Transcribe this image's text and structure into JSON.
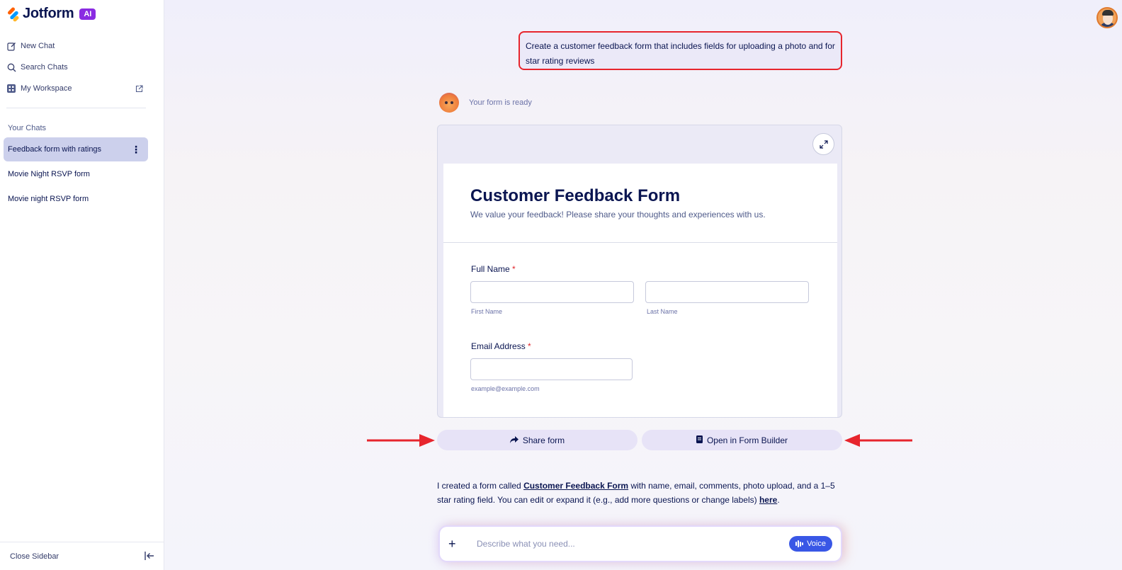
{
  "brand": {
    "name": "Jotform",
    "badge": "AI"
  },
  "sidebar": {
    "nav": [
      {
        "label": "New Chat",
        "icon": "edit-icon"
      },
      {
        "label": "Search Chats",
        "icon": "search-icon"
      },
      {
        "label": "My Workspace",
        "icon": "workspace-icon"
      }
    ],
    "section_title": "Your Chats",
    "chats": [
      {
        "label": "Feedback form with ratings",
        "active": true
      },
      {
        "label": "Movie Night RSVP form",
        "active": false
      },
      {
        "label": "Movie night RSVP form",
        "active": false
      }
    ],
    "close_label": "Close Sidebar"
  },
  "conversation": {
    "user_prompt": "Create a customer feedback form that includes fields for uploading a photo and for star rating reviews",
    "bot_status": "Your form is ready",
    "form": {
      "title": "Customer Feedback Form",
      "subtitle": "We value your feedback! Please share your thoughts and experiences with us.",
      "full_name_label": "Full Name",
      "required_mark": "*",
      "first_name_sub": "First Name",
      "last_name_sub": "Last Name",
      "email_label": "Email Address",
      "email_sub": "example@example.com"
    },
    "share_button": "Share form",
    "builder_button": "Open in Form Builder",
    "reply": {
      "prefix": "I created a form called ",
      "form_link": "Customer Feedback Form",
      "middle": " with name, email, comments, photo upload, and a 1–5 star rating field. You can edit or expand it (e.g., add more questions or change labels) ",
      "here_link": "here",
      "suffix": "."
    }
  },
  "composer": {
    "placeholder": "Describe what you need...",
    "voice_label": "Voice"
  },
  "colors": {
    "accent": "#3957e6",
    "highlight": "#e7252d",
    "brand_ai": "#8a2be2"
  }
}
